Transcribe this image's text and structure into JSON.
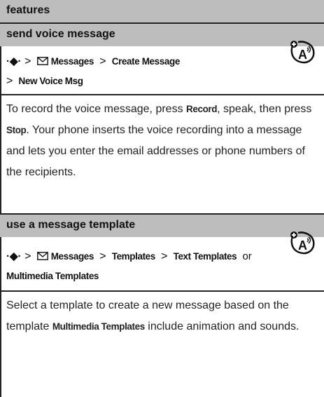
{
  "header": {
    "title": "features"
  },
  "sections": [
    {
      "title": "send voice message",
      "path": {
        "nav_glyph": "·◆·",
        "line1": [
          "Messages",
          "Create Message"
        ],
        "line2": [
          "New Voice Msg"
        ]
      },
      "body": {
        "parts": [
          "To record the voice message, press ",
          "Record",
          ", speak, then press ",
          "Stop",
          ". Your phone inserts the voice recording into a message and lets you enter the email addresses or phone numbers of the recipients."
        ]
      }
    },
    {
      "title": "use a message template",
      "path": {
        "nav_glyph": "·◆·",
        "line1": [
          "Messages",
          "Templates",
          "Text Templates"
        ],
        "line1_suffix": "or",
        "line2": [
          "Multimedia Templates"
        ]
      },
      "body": {
        "parts": [
          "Select a template to create a new message based on the template ",
          "Multimedia Templates",
          " include animation and sounds."
        ]
      }
    }
  ],
  "icons": {
    "network_feature": "network-dependent-feature-icon",
    "menu_nav": "nav-key-icon",
    "messages": "envelope-icon"
  }
}
